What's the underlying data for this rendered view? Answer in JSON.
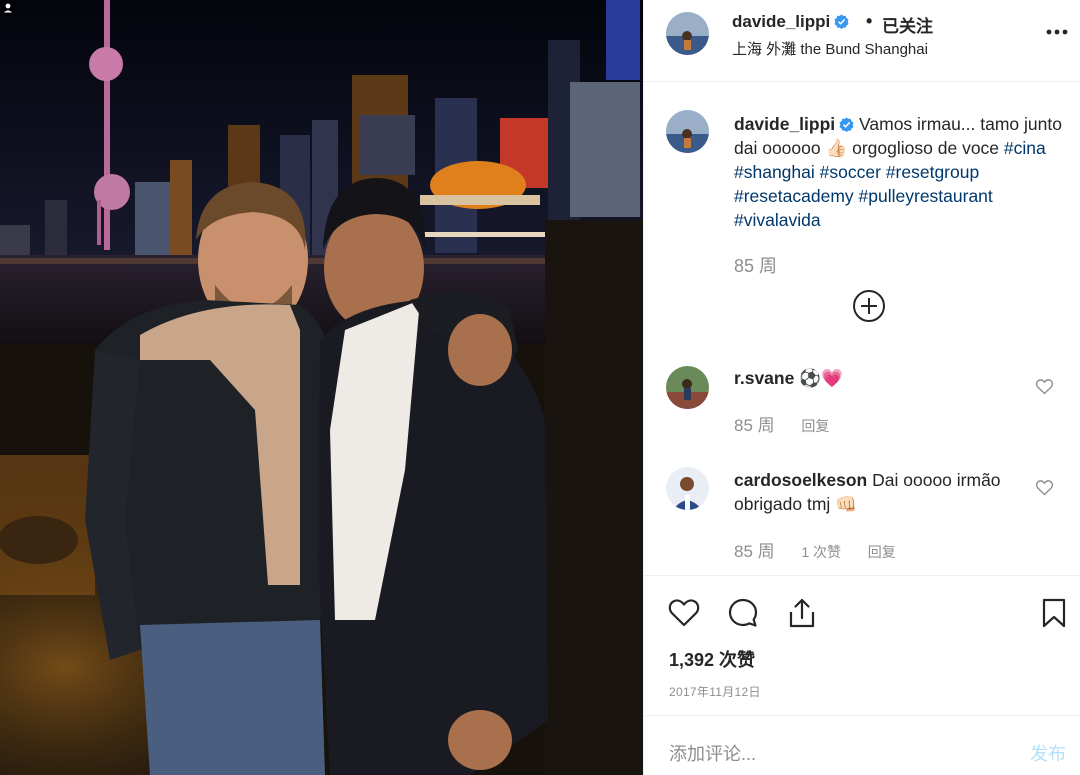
{
  "post": {
    "username": "davide_lippi",
    "follow_status": "已关注",
    "separator": "•",
    "location": "上海 外灘 the Bund Shanghai",
    "more_icon": "more-horizontal-icon",
    "verified_icon": "verified-badge-icon"
  },
  "caption": {
    "username": "davide_lippi",
    "text_1": "Vamos irmau... tamo junto dai oooooo 👍🏻 orgoglioso de voce",
    "hashtags_1": [
      "#cina",
      "#shanghai",
      "#soccer",
      "#resetgroup",
      "#resetacademy",
      "#pulleyrestaurant",
      "#vivalavida"
    ],
    "time": "85 周"
  },
  "load_more_icon": "plus-circle-icon",
  "comments": [
    {
      "username": "r.svane",
      "text": "⚽️💗",
      "time": "85 周",
      "likes": "",
      "reply": "回复"
    },
    {
      "username": "cardosoelkeson",
      "text": "Dai ooooo irmão obrigado tmj 👊🏻",
      "time": "85 周",
      "likes": "1 次赞",
      "reply": "回复"
    }
  ],
  "actions": {
    "like_icon": "heart-icon",
    "comment_icon": "comment-icon",
    "share_icon": "share-icon",
    "save_icon": "bookmark-icon",
    "likes_count": "1,392 次赞",
    "date": "2017年11月12日"
  },
  "add_comment": {
    "placeholder": "添加评论...",
    "post_label": "发布"
  },
  "colors": {
    "hashtag": "#00376b",
    "verified": "#3897f0",
    "muted": "#8e8e8e",
    "post_disabled": "#b2dffc"
  }
}
